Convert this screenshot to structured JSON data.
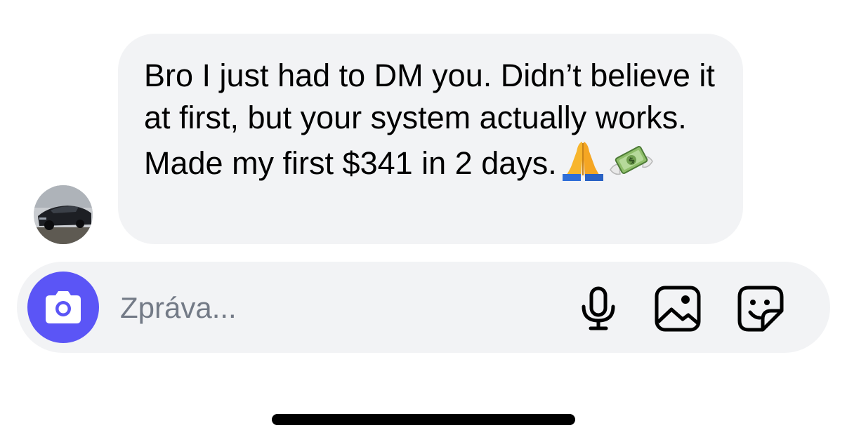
{
  "conversation": {
    "avatar_icon": "profile-photo-car",
    "message_text": "Bro I just had to DM you. Didn’t believe it at first, but your system actually works. Made my first $341 in 2 days.",
    "emojis": [
      "folded-hands",
      "money-with-wings"
    ]
  },
  "composer": {
    "placeholder": "Zpráva...",
    "value": "",
    "camera_icon": "camera-icon",
    "mic_icon": "microphone-icon",
    "gallery_icon": "image-icon",
    "sticker_icon": "sticker-icon",
    "accent_color": "#5b55f6"
  },
  "colors": {
    "bubble": "#f2f3f5",
    "composer": "#f2f3f5",
    "placeholder": "#737a86"
  }
}
